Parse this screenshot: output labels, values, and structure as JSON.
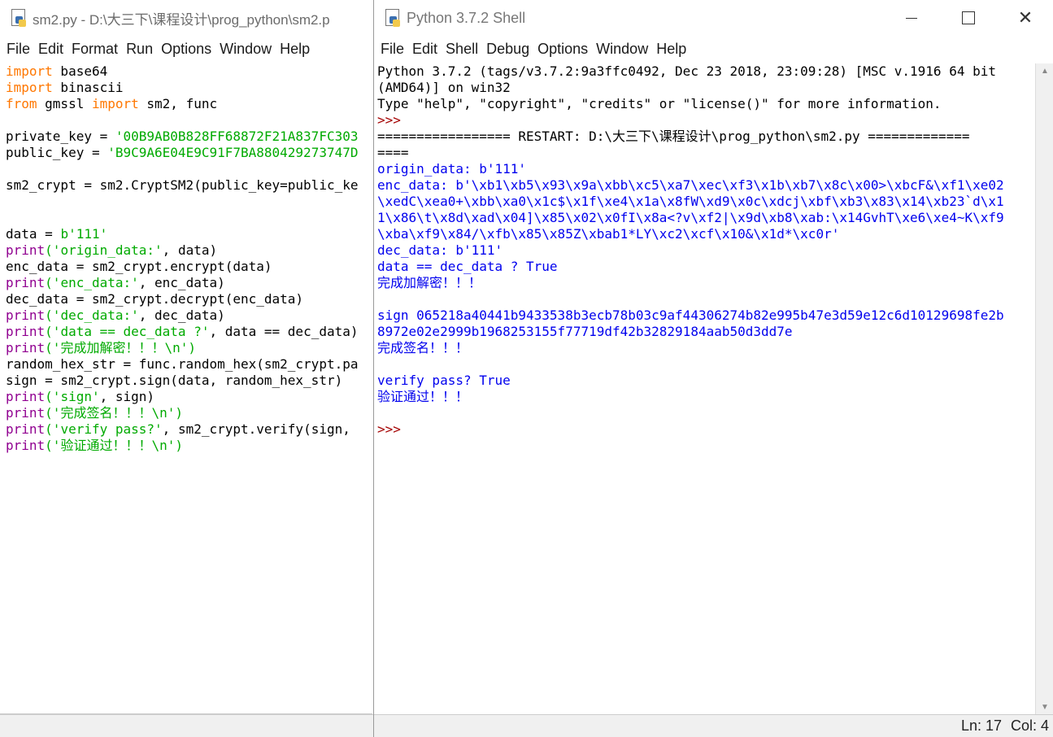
{
  "editor": {
    "title": "sm2.py - D:\\大三下\\课程设计\\prog_python\\sm2.p",
    "menu": [
      "File",
      "Edit",
      "Format",
      "Run",
      "Options",
      "Window",
      "Help"
    ],
    "code": [
      [
        {
          "t": "import",
          "c": "kw"
        },
        {
          "t": " base64",
          "c": ""
        }
      ],
      [
        {
          "t": "import",
          "c": "kw"
        },
        {
          "t": " binascii",
          "c": ""
        }
      ],
      [
        {
          "t": "from",
          "c": "kw"
        },
        {
          "t": " gmssl ",
          "c": ""
        },
        {
          "t": "import",
          "c": "kw"
        },
        {
          "t": " sm2, func",
          "c": ""
        }
      ],
      [],
      [
        {
          "t": "private_key = ",
          "c": ""
        },
        {
          "t": "'00B9AB0B828FF68872F21A837FC303",
          "c": "st"
        }
      ],
      [
        {
          "t": "public_key = ",
          "c": ""
        },
        {
          "t": "'B9C9A6E04E9C91F7BA880429273747D",
          "c": "st"
        }
      ],
      [],
      [
        {
          "t": "sm2_crypt = sm2.CryptSM2(public_key=public_ke",
          "c": ""
        }
      ],
      [],
      [],
      [
        {
          "t": "data = ",
          "c": ""
        },
        {
          "t": "b'111'",
          "c": "st"
        }
      ],
      [
        {
          "t": "print",
          "c": "bi"
        },
        {
          "t": "('origin_data:'",
          "c": "st"
        },
        {
          "t": ", data)",
          "c": ""
        }
      ],
      [
        {
          "t": "enc_data = sm2_crypt.encrypt(data)",
          "c": ""
        }
      ],
      [
        {
          "t": "print",
          "c": "bi"
        },
        {
          "t": "('enc_data:'",
          "c": "st"
        },
        {
          "t": ", enc_data)",
          "c": ""
        }
      ],
      [
        {
          "t": "dec_data = sm2_crypt.decrypt(enc_data)",
          "c": ""
        }
      ],
      [
        {
          "t": "print",
          "c": "bi"
        },
        {
          "t": "('dec_data:'",
          "c": "st"
        },
        {
          "t": ", dec_data)",
          "c": ""
        }
      ],
      [
        {
          "t": "print",
          "c": "bi"
        },
        {
          "t": "('data == dec_data ?'",
          "c": "st"
        },
        {
          "t": ", data == dec_data)",
          "c": ""
        }
      ],
      [
        {
          "t": "print",
          "c": "bi"
        },
        {
          "t": "('完成加解密！！！\\n')",
          "c": "st"
        }
      ],
      [
        {
          "t": "random_hex_str = func.random_hex(sm2_crypt.pa",
          "c": ""
        }
      ],
      [
        {
          "t": "sign = sm2_crypt.sign(data, random_hex_str)",
          "c": ""
        }
      ],
      [
        {
          "t": "print",
          "c": "bi"
        },
        {
          "t": "('sign'",
          "c": "st"
        },
        {
          "t": ", sign)",
          "c": ""
        }
      ],
      [
        {
          "t": "print",
          "c": "bi"
        },
        {
          "t": "('完成签名！！！\\n')",
          "c": "st"
        }
      ],
      [
        {
          "t": "print",
          "c": "bi"
        },
        {
          "t": "('verify pass?'",
          "c": "st"
        },
        {
          "t": ", sm2_crypt.verify(sign,",
          "c": ""
        }
      ],
      [
        {
          "t": "print",
          "c": "bi"
        },
        {
          "t": "('验证通过！！！\\n')",
          "c": "st"
        }
      ]
    ]
  },
  "shell": {
    "title": "Python 3.7.2 Shell",
    "menu": [
      "File",
      "Edit",
      "Shell",
      "Debug",
      "Options",
      "Window",
      "Help"
    ],
    "lines": [
      {
        "t": "Python 3.7.2 (tags/v3.7.2:9a3ffc0492, Dec 23 2018, 23:09:28) [MSC v.1916 64 bit",
        "c": "sh-std"
      },
      {
        "t": "(AMD64)] on win32",
        "c": "sh-std"
      },
      {
        "t": "Type \"help\", \"copyright\", \"credits\" or \"license()\" for more information.",
        "c": "sh-std"
      },
      {
        "t": ">>>",
        "c": "sh-prompt"
      },
      {
        "t": "================= RESTART: D:\\大三下\\课程设计\\prog_python\\sm2.py =============",
        "c": "sh-std"
      },
      {
        "t": "====",
        "c": "sh-std"
      },
      {
        "t": "origin_data: b'111'",
        "c": "sh-out"
      },
      {
        "t": "enc_data: b'\\xb1\\xb5\\x93\\x9a\\xbb\\xc5\\xa7\\xec\\xf3\\x1b\\xb7\\x8c\\x00>\\xbcF&\\xf1\\xe02",
        "c": "sh-out"
      },
      {
        "t": "\\xedC\\xea0+\\xbb\\xa0\\x1c$\\x1f\\xe4\\x1a\\x8fW\\xd9\\x0c\\xdcj\\xbf\\xb3\\x83\\x14\\xb23`d\\x1",
        "c": "sh-out"
      },
      {
        "t": "1\\x86\\t\\x8d\\xad\\x04]\\x85\\x02\\x0fI\\x8a<?v\\xf2|\\x9d\\xb8\\xab:\\x14GvhT\\xe6\\xe4~K\\xf9",
        "c": "sh-out"
      },
      {
        "t": "\\xba\\xf9\\x84/\\xfb\\x85\\x85Z\\xbab1*LY\\xc2\\xcf\\x10&\\x1d*\\xc0r'",
        "c": "sh-out"
      },
      {
        "t": "dec_data: b'111'",
        "c": "sh-out"
      },
      {
        "t": "data == dec_data ? True",
        "c": "sh-out"
      },
      {
        "t": "完成加解密！！！",
        "c": "sh-out"
      },
      {
        "t": "",
        "c": "sh-out"
      },
      {
        "t": "sign 065218a40441b9433538b3ecb78b03c9af44306274b82e995b47e3d59e12c6d10129698fe2b",
        "c": "sh-out"
      },
      {
        "t": "8972e02e2999b1968253155f77719df42b32829184aab50d3dd7e",
        "c": "sh-out"
      },
      {
        "t": "完成签名！！！",
        "c": "sh-out"
      },
      {
        "t": "",
        "c": "sh-out"
      },
      {
        "t": "verify pass? True",
        "c": "sh-out"
      },
      {
        "t": "验证通过！！！",
        "c": "sh-out"
      },
      {
        "t": "",
        "c": "sh-out"
      },
      {
        "t": ">>>",
        "c": "sh-prompt"
      }
    ],
    "status": {
      "line": "Ln: 17",
      "col": "Col: 4"
    }
  }
}
